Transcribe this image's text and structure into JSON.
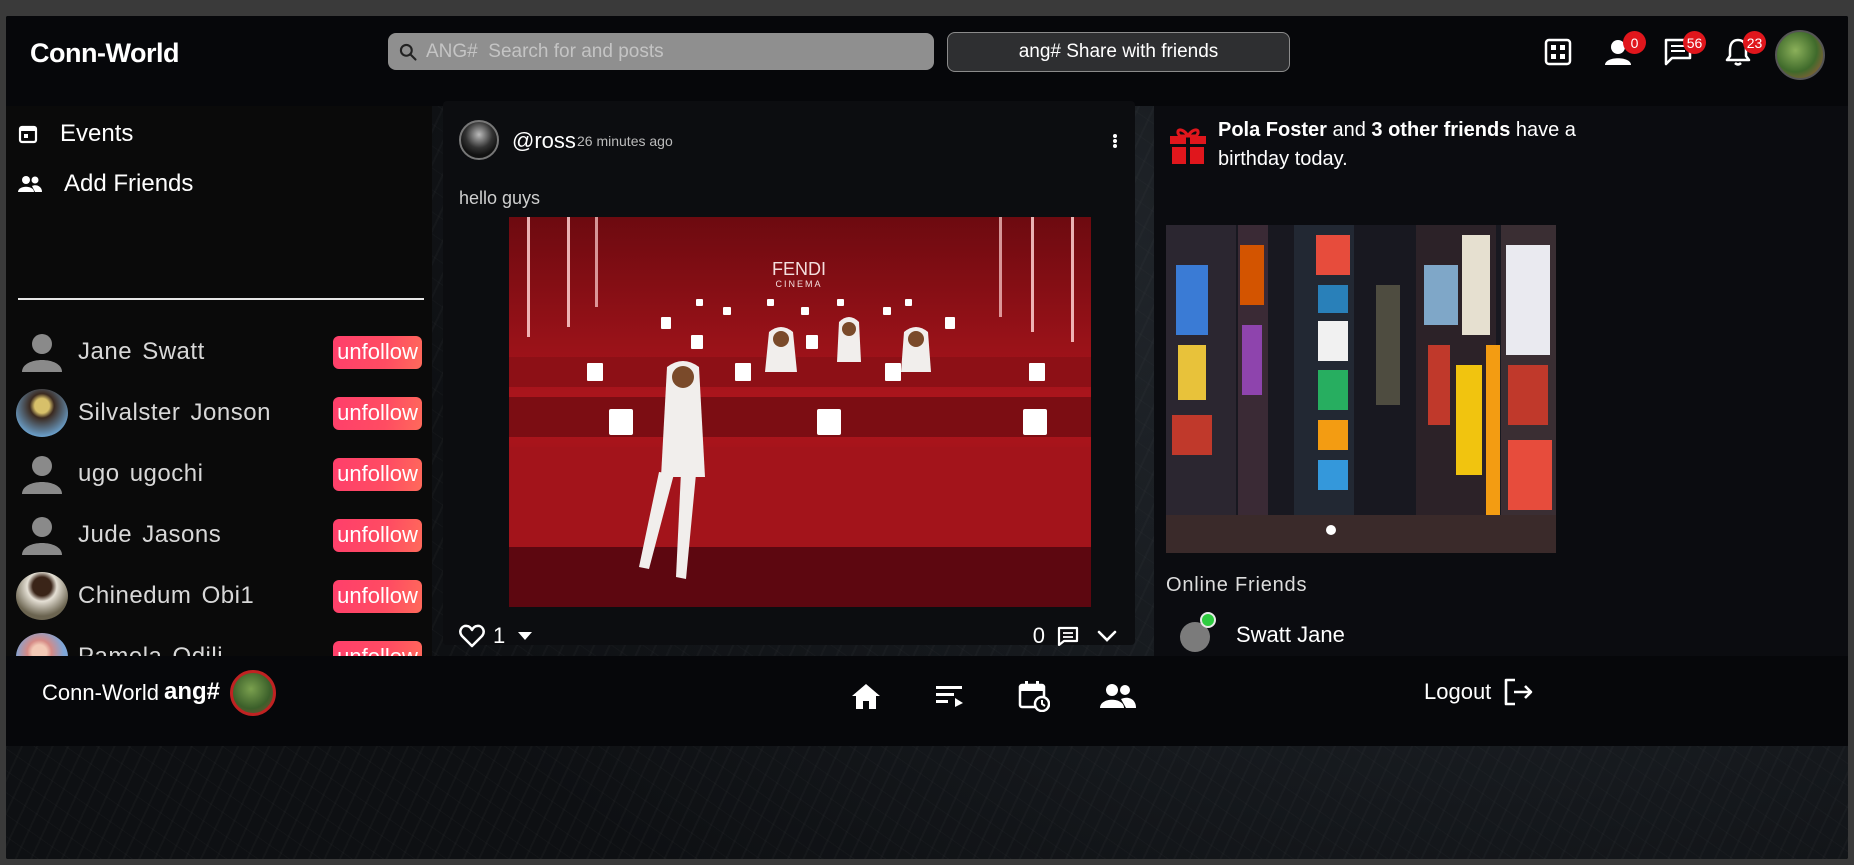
{
  "header": {
    "logo": "Conn-World",
    "search_placeholder": "ANG#  Search for and posts",
    "share_label": "ang# Share with friends",
    "badges": {
      "friends": "0",
      "messages": "56",
      "notifications": "23"
    }
  },
  "sidebar": {
    "items": [
      {
        "label": "Events",
        "icon": "calendar-icon"
      },
      {
        "label": "Add Friends",
        "icon": "people-icon"
      }
    ],
    "friends": [
      {
        "name": "Jane  Swatt",
        "action": "unfollow",
        "avatar": "default"
      },
      {
        "name": "Silvalster  Jonson",
        "action": "unfollow",
        "avatar": "photo"
      },
      {
        "name": "ugo  ugochi",
        "action": "unfollow",
        "avatar": "default"
      },
      {
        "name": "Jude  Jasons",
        "action": "unfollow",
        "avatar": "default"
      },
      {
        "name": "Chinedum  Obi1",
        "action": "unfollow",
        "avatar": "photo"
      },
      {
        "name": "Pamela  Odili",
        "action": "unfollow",
        "avatar": "photo"
      }
    ]
  },
  "post": {
    "username": "@ross",
    "time": "26 minutes ago",
    "text": "hello guys",
    "image_sign": "FENDI",
    "image_sign_sub": "CINEMA",
    "likes": "1",
    "comments": "0"
  },
  "right": {
    "birthday": {
      "name": "Pola Foster",
      "mid": " and ",
      "others": "3 other friends",
      "tail": " have a birthday today."
    },
    "online_title": "Online Friends",
    "online_friends": [
      {
        "name": "Swatt Jane"
      }
    ]
  },
  "footer": {
    "logo": "Conn-World",
    "user": "ang#",
    "logout": "Logout"
  },
  "colors": {
    "accent": "#ff4466",
    "badge": "#e0161c",
    "online": "#2ecc40",
    "gift": "#e0161c"
  }
}
